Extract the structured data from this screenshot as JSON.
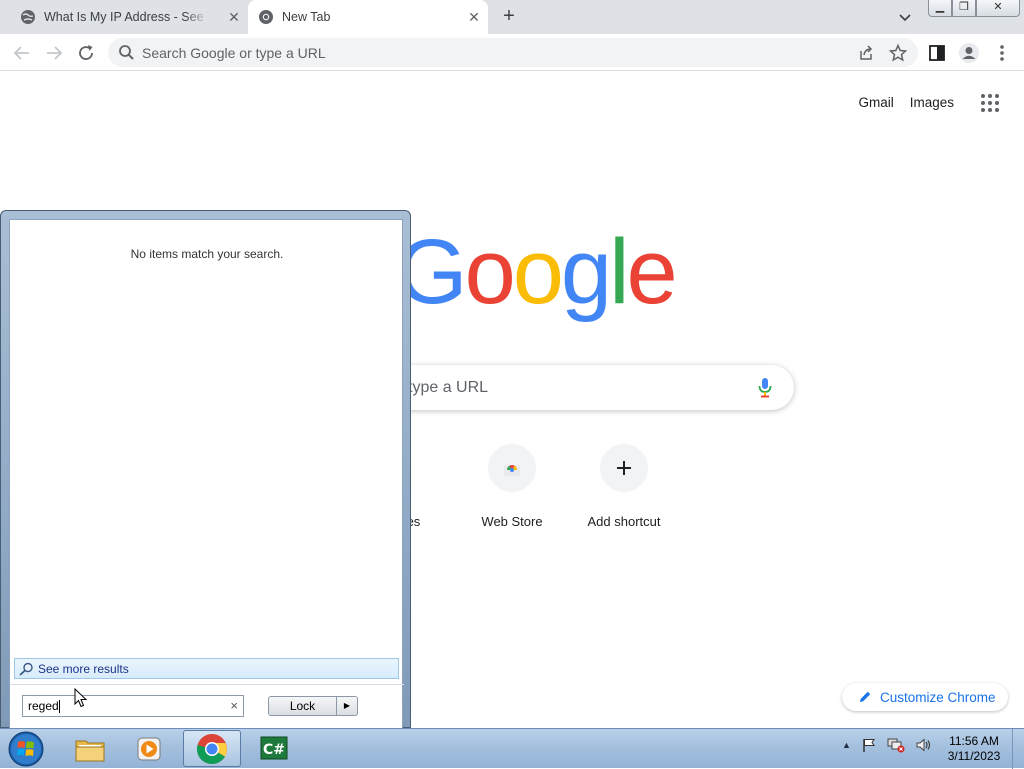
{
  "browser": {
    "tabs": [
      {
        "title": "What Is My IP Address - See Your Public",
        "active": false
      },
      {
        "title": "New Tab",
        "active": true
      }
    ],
    "omnibox_placeholder": "Search Google or type a URL"
  },
  "ntp": {
    "links": {
      "gmail": "Gmail",
      "images": "Images"
    },
    "logo": {
      "text": "Google",
      "colors": [
        "#4285F4",
        "#EA4335",
        "#FBBC05",
        "#4285F4",
        "#34A853",
        "#EA4335"
      ]
    },
    "search_placeholder": "Search Google or type a URL",
    "search_visible_text": "type a URL",
    "shortcuts": [
      {
        "label": "les",
        "icon": "site-icon"
      },
      {
        "label": "Web Store",
        "icon": "webstore-icon"
      },
      {
        "label": "Add shortcut",
        "icon": "plus-icon"
      }
    ],
    "customize_label": "Customize Chrome"
  },
  "startmenu": {
    "no_items_text": "No items match your search.",
    "see_more_label": "See more results",
    "search_value": "reged",
    "lock_label": "Lock"
  },
  "taskbar": {
    "apps": [
      {
        "name": "Windows Explorer",
        "icon": "folder-icon"
      },
      {
        "name": "Windows Media Player",
        "icon": "media-player-icon"
      },
      {
        "name": "Google Chrome",
        "icon": "chrome-icon",
        "active": true
      },
      {
        "name": "C# project",
        "icon": "csharp-icon"
      }
    ],
    "time": "11:56 AM",
    "date": "3/11/2023"
  }
}
